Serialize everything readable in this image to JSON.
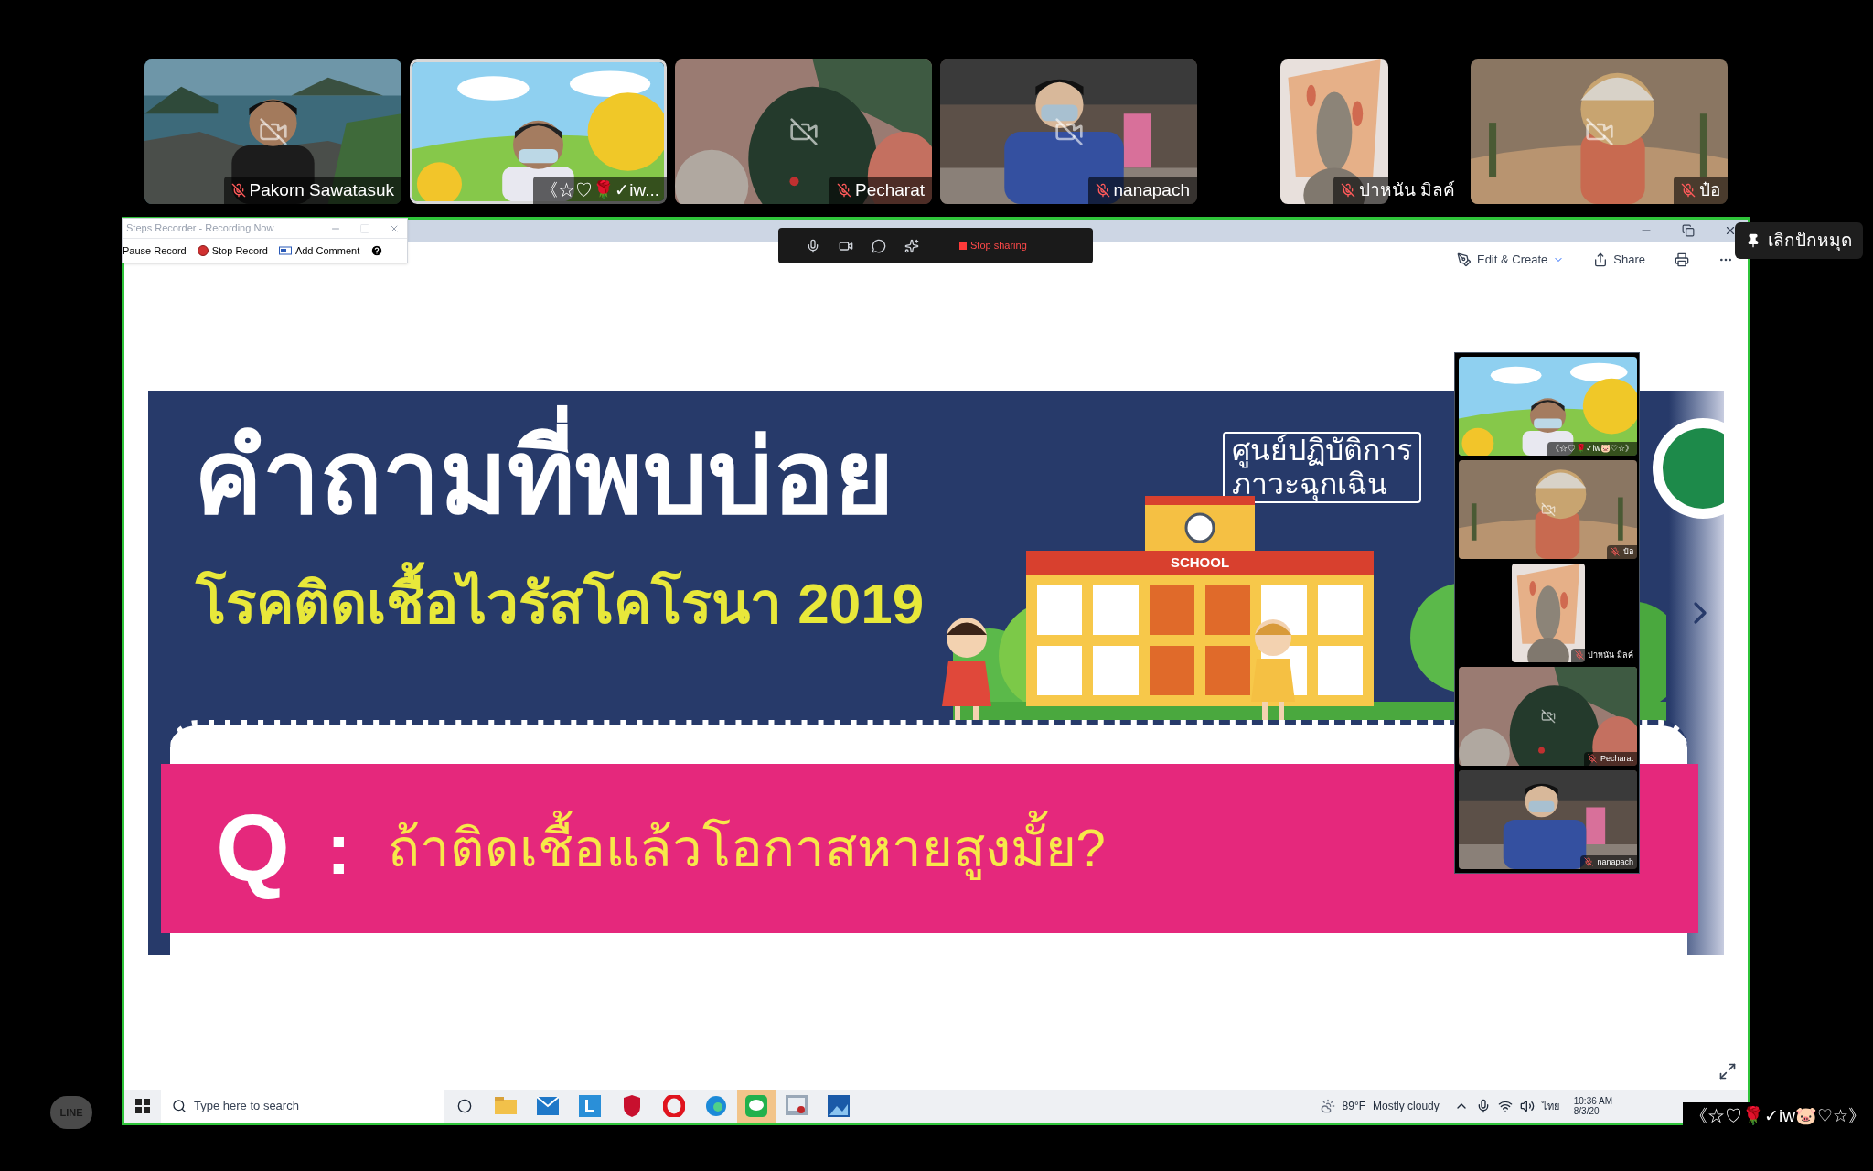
{
  "participants": [
    {
      "name": "Pakorn Sawatasuk",
      "muted": true,
      "camera_off": true,
      "selected": false,
      "kind": "landscape"
    },
    {
      "name": "《☆♡🌹✓iw...",
      "muted": false,
      "camera_off": false,
      "selected": true,
      "kind": "landscape"
    },
    {
      "name": "Pecharat",
      "muted": true,
      "camera_off": true,
      "selected": false,
      "kind": "landscape"
    },
    {
      "name": "nanapach",
      "muted": true,
      "camera_off": true,
      "selected": false,
      "kind": "landscape"
    },
    {
      "name": "ปาหนัน มิลค์",
      "muted": true,
      "camera_off": false,
      "selected": false,
      "kind": "portrait"
    },
    {
      "name": "ป๋อ",
      "muted": true,
      "camera_off": true,
      "selected": false,
      "kind": "landscape"
    }
  ],
  "steps_recorder": {
    "title": "Steps Recorder - Recording Now",
    "buttons": [
      "Pause Record",
      "Stop Record",
      "Add Comment"
    ]
  },
  "meeting_toolbar": {
    "stop_label": "Stop sharing"
  },
  "pin_tooltip": "เลิกปักหมุด",
  "viewer_toolbar": [
    "Edit & Create",
    "Share"
  ],
  "slide": {
    "title": "คำถามที่พบบ่อย",
    "subtitle": "โรคติดเชื้อไวรัสโคโรนา 2019",
    "badge_lines": [
      "ศูนย์ปฏิบัติการ",
      "ภาวะฉุกเฉิน"
    ],
    "school_sign": "SCHOOL",
    "q_letter": "Q",
    "q_colon": ":",
    "question": "ถ้าติดเชื้อแล้วโอกาสหายสูงมั้ย?"
  },
  "thumbnails": [
    {
      "name": "《☆♡🌹✓iw🐷♡☆》",
      "muted": false,
      "camera_off": false,
      "kind": "landscape"
    },
    {
      "name": "ป๋อ",
      "muted": true,
      "camera_off": true,
      "kind": "landscape"
    },
    {
      "name": "ปาหนัน มิลค์",
      "muted": true,
      "camera_off": false,
      "kind": "portrait"
    },
    {
      "name": "Pecharat",
      "muted": true,
      "camera_off": true,
      "kind": "landscape"
    },
    {
      "name": "nanapach",
      "muted": true,
      "camera_off": false,
      "kind": "landscape"
    }
  ],
  "taskbar": {
    "search_placeholder": "Type here to search",
    "weather": "89°F",
    "weather_text": "Mostly cloudy",
    "language": "ไทย",
    "time": "10:36 AM",
    "date": "8/3/20"
  },
  "self_name": "《☆♡🌹✓iw🐷♡☆》",
  "line_logo": "LINE"
}
